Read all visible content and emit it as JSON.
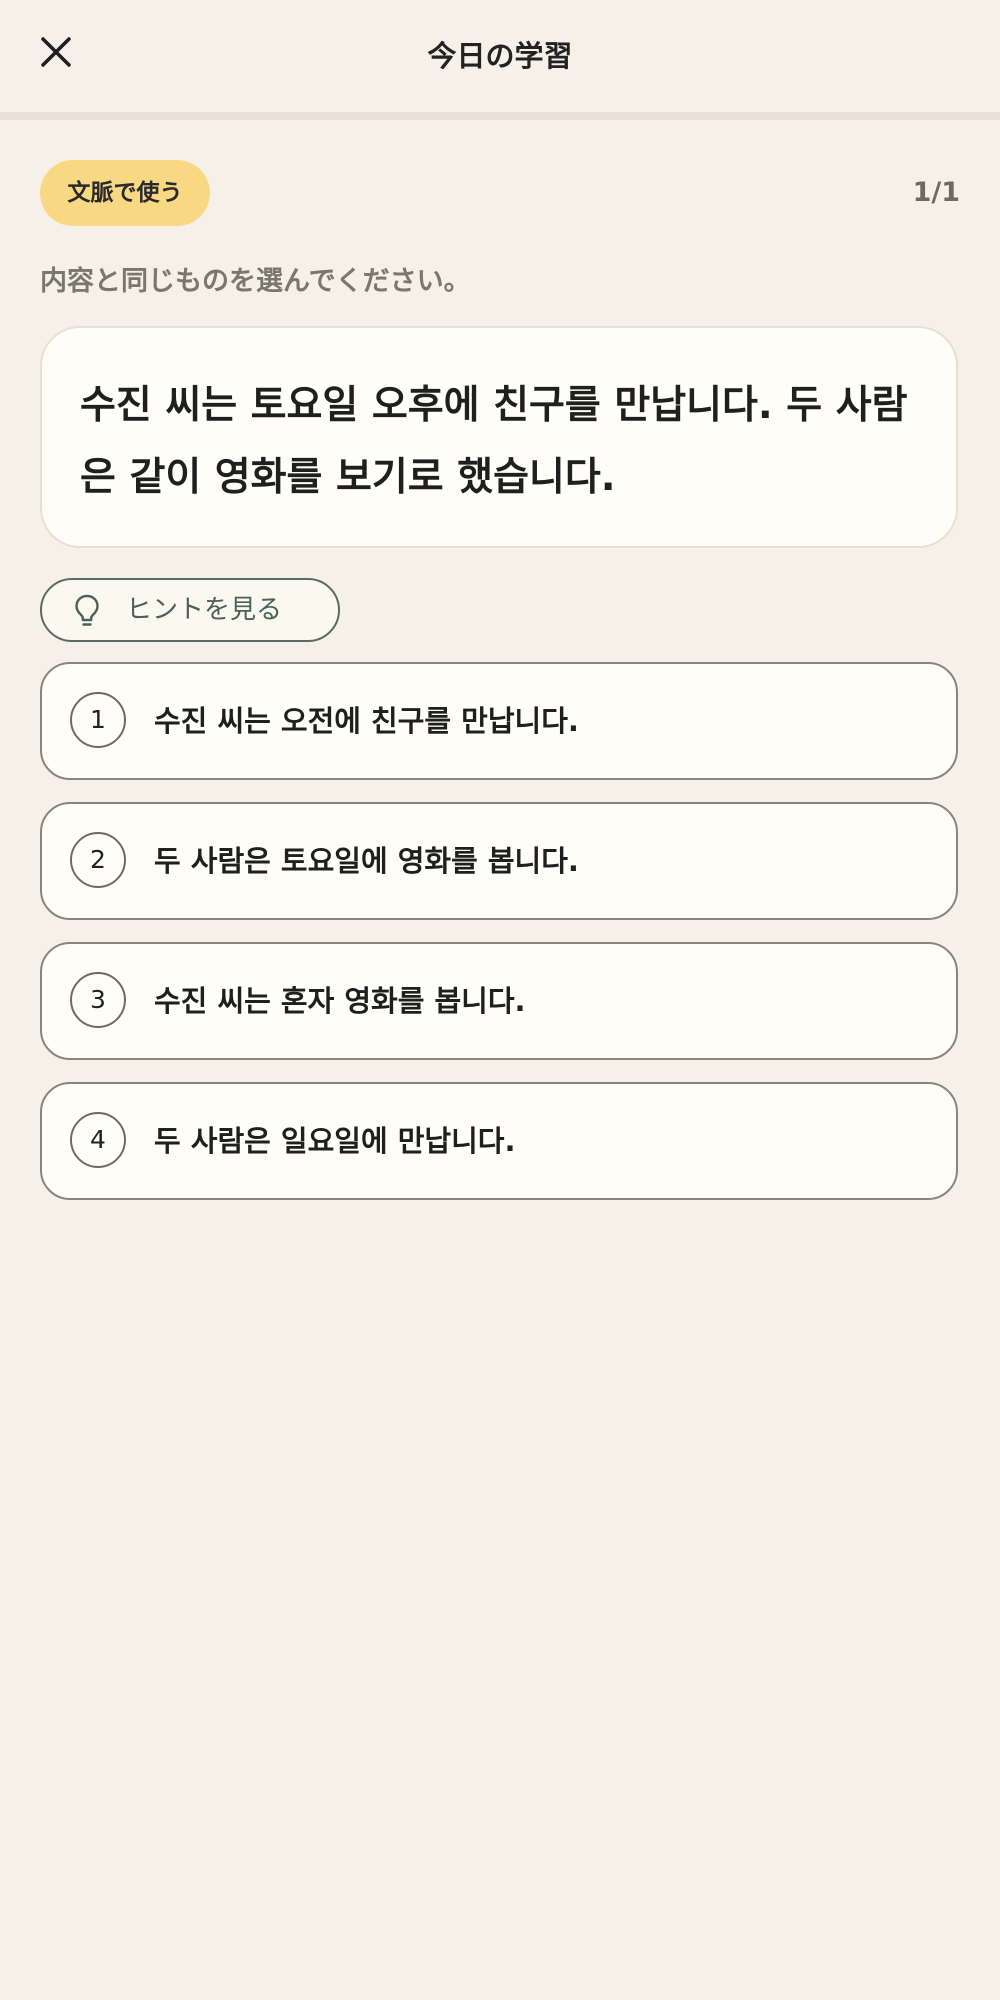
{
  "header": {
    "title": "今日の学習",
    "close_icon": "close-icon"
  },
  "progress": {
    "fraction": 1.0
  },
  "question": {
    "tag": "文脈で使う",
    "counter": "1/1",
    "instruction": "内容と同じものを選んでください。",
    "passage": "수진 씨는 토요일 오후에 친구를 만납니다. 두 사람은 같이 영화를 보기로 했습니다."
  },
  "hint": {
    "label": "ヒントを見る",
    "icon": "lightbulb-icon"
  },
  "options": [
    {
      "number": "1",
      "text": "수진 씨는 오전에 친구를 만납니다."
    },
    {
      "number": "2",
      "text": "두 사람은 토요일에 영화를 봅니다."
    },
    {
      "number": "3",
      "text": "수진 씨는 혼자 영화를 봅니다."
    },
    {
      "number": "4",
      "text": "두 사람은 일요일에 만납니다."
    }
  ],
  "colors": {
    "background": "#f5f1e8",
    "tag": "#f8d882",
    "card": "#fffdf7",
    "hint_accent": "#4b6257"
  }
}
